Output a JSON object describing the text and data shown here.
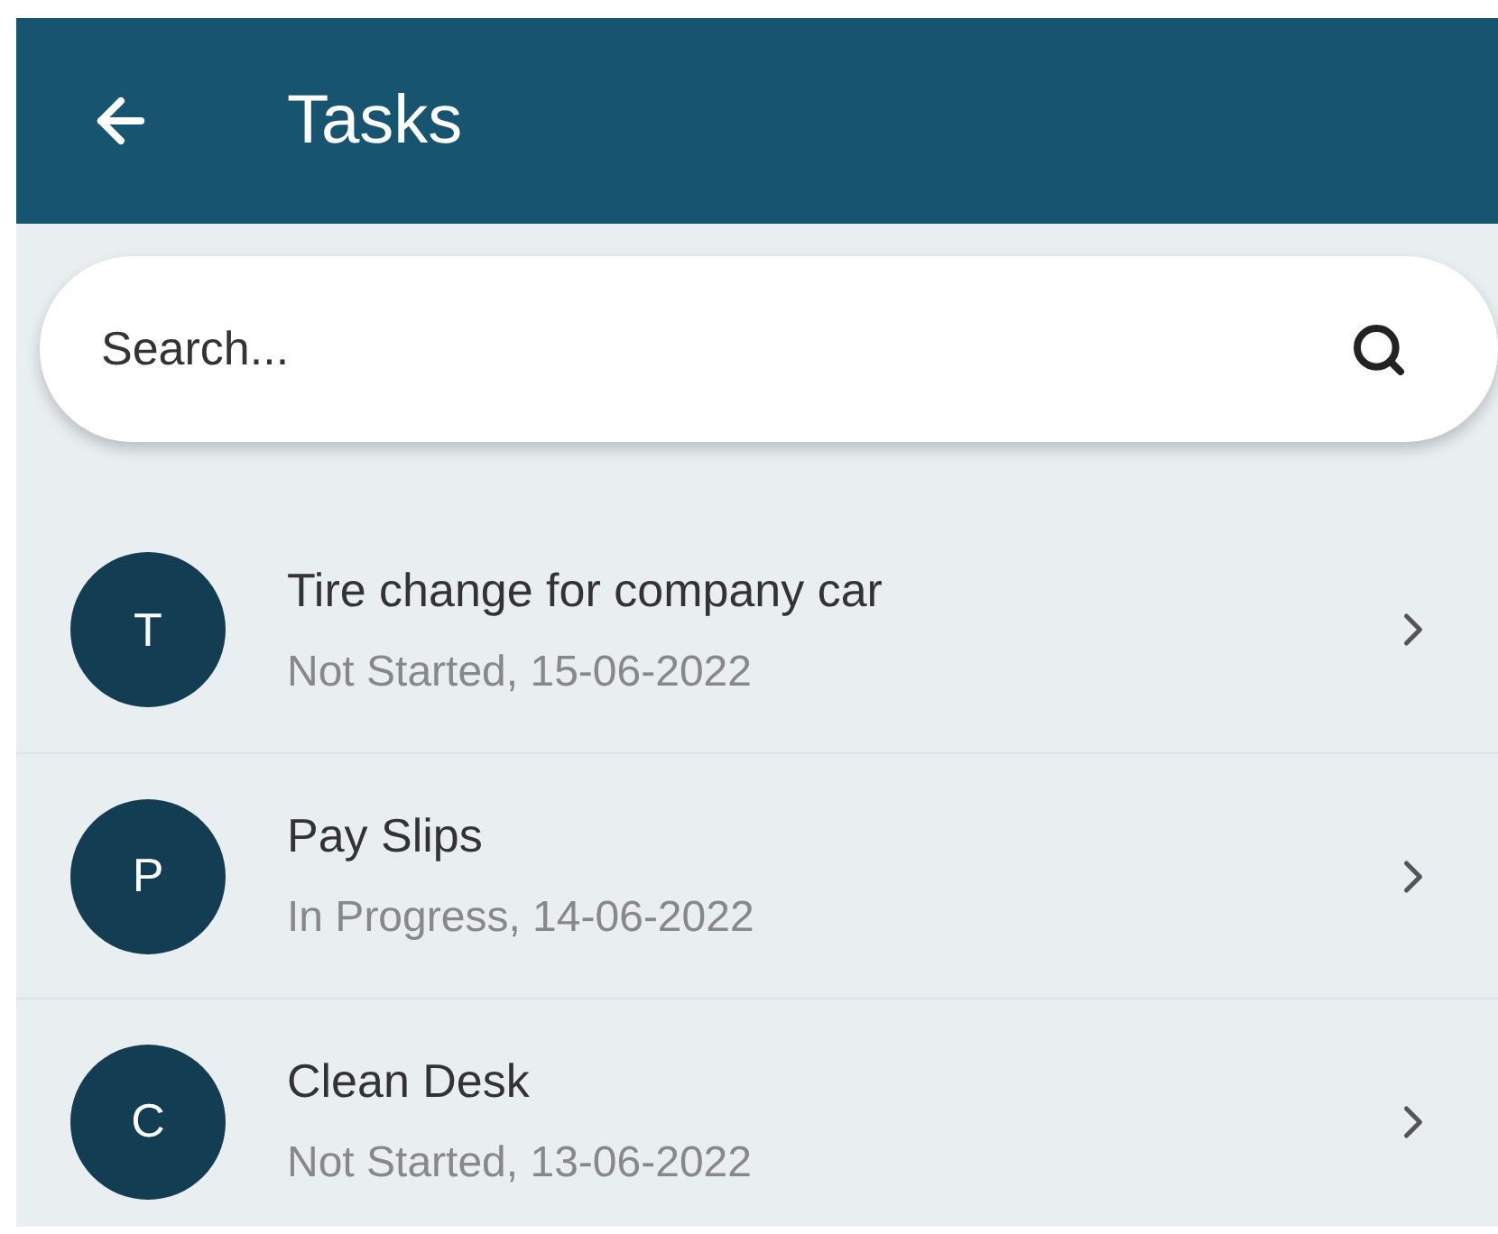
{
  "header": {
    "title": "Tasks"
  },
  "search": {
    "placeholder": "Search..."
  },
  "tasks": [
    {
      "initial": "T",
      "title": "Tire change for company car",
      "subtitle": "Not Started, 15-06-2022"
    },
    {
      "initial": "P",
      "title": "Pay Slips",
      "subtitle": "In Progress, 14-06-2022"
    },
    {
      "initial": "C",
      "title": "Clean Desk",
      "subtitle": "Not Started, 13-06-2022"
    }
  ]
}
